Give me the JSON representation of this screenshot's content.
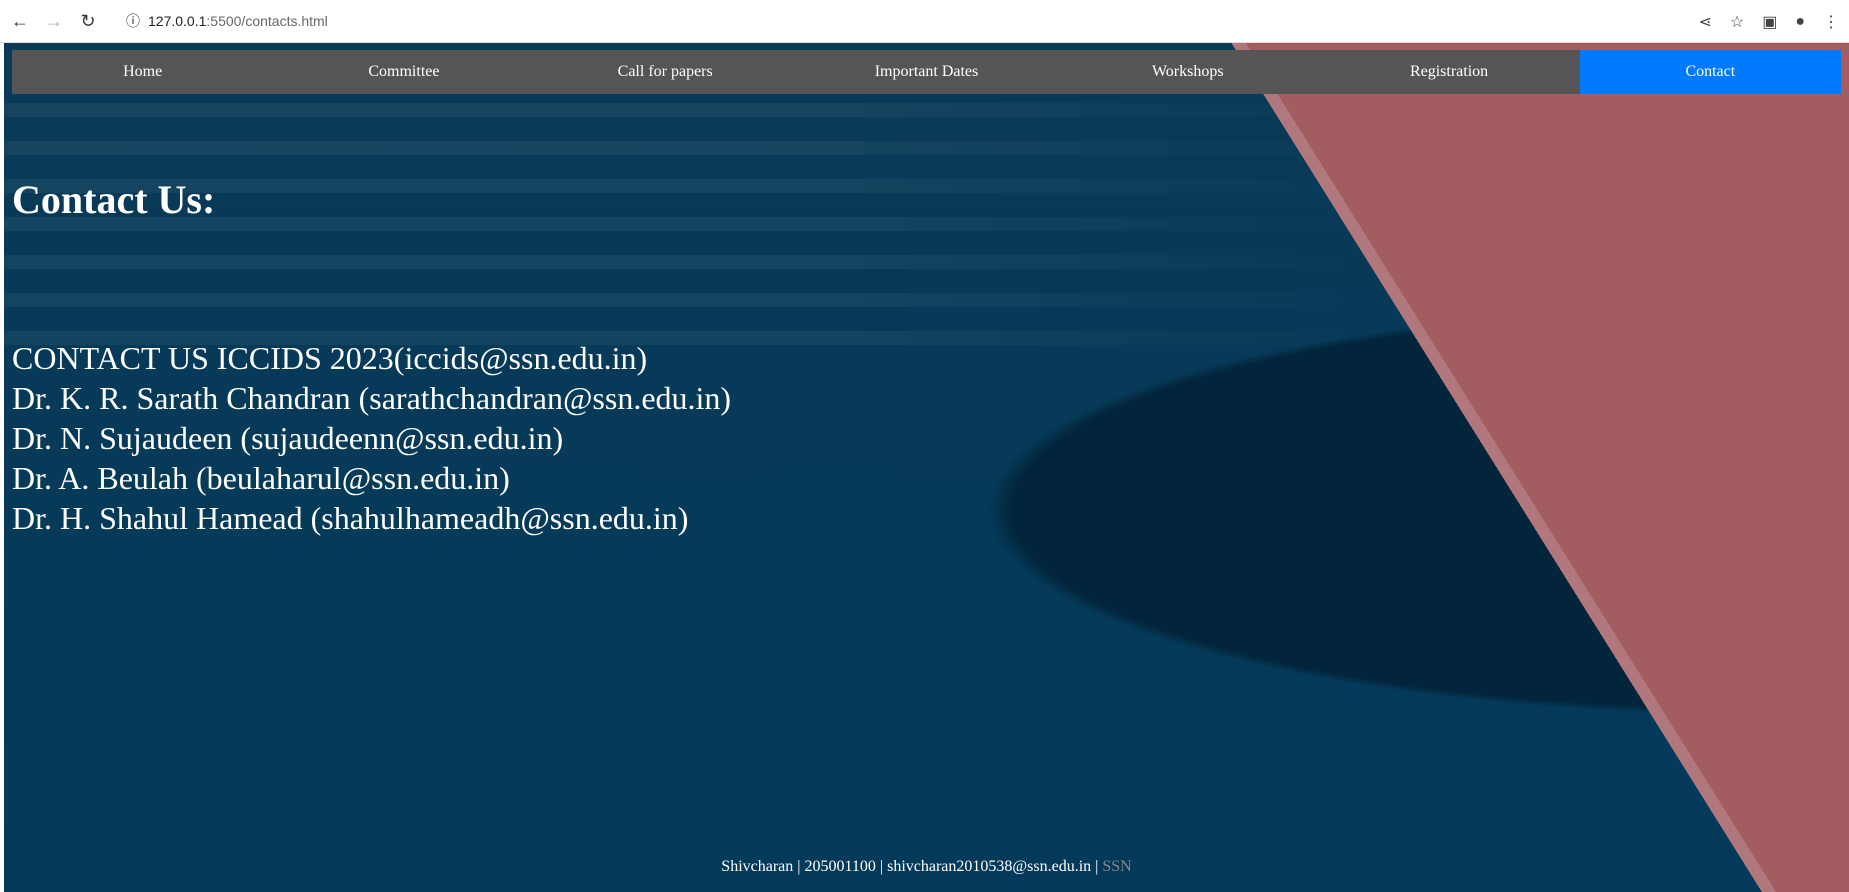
{
  "browser": {
    "url_host": "127.0.0.1",
    "url_path": ":5500/contacts.html"
  },
  "nav": [
    {
      "label": "Home",
      "active": false
    },
    {
      "label": "Committee",
      "active": false
    },
    {
      "label": "Call for papers",
      "active": false
    },
    {
      "label": "Important Dates",
      "active": false
    },
    {
      "label": "Workshops",
      "active": false
    },
    {
      "label": "Registration",
      "active": false
    },
    {
      "label": "Contact",
      "active": true
    }
  ],
  "colors": {
    "nav_bg": "#555555",
    "nav_active": "#007bff"
  },
  "heading": "Contact Us:",
  "contacts": [
    "CONTACT US ICCIDS 2023(iccids@ssn.edu.in)",
    "Dr. K. R. Sarath Chandran (sarathchandran@ssn.edu.in)",
    "Dr. N. Sujaudeen (sujaudeenn@ssn.edu.in)",
    "Dr. A. Beulah (beulaharul@ssn.edu.in)",
    "Dr. H. Shahul Hamead (shahulhameadh@ssn.edu.in)"
  ],
  "footer": {
    "name": "Shivcharan",
    "id": "205001100",
    "email": "shivcharan2010538@ssn.edu.in",
    "sep": " | ",
    "org": "SSN"
  }
}
